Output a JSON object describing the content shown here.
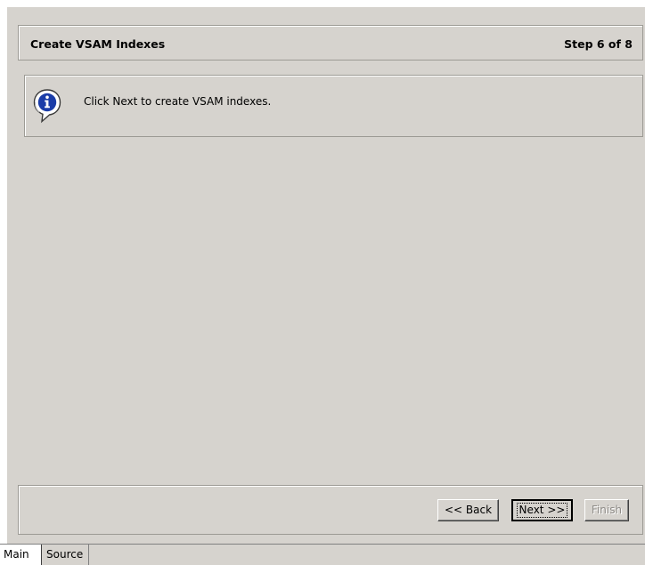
{
  "wizard": {
    "title": "Create VSAM Indexes",
    "step": "Step 6 of 8",
    "info_icon": "info-icon",
    "info_message": "Click Next to create VSAM indexes.",
    "buttons": {
      "back": "<< Back",
      "next": "Next >>",
      "finish": "Finish"
    }
  },
  "tabs": [
    {
      "label": "Main",
      "active": true
    },
    {
      "label": "Source",
      "active": false
    }
  ],
  "colors": {
    "panel": "#d6d3ce",
    "border": "#9c9a94",
    "icon_blue": "#1a3ca8",
    "disabled_text": "#8f8c88"
  }
}
